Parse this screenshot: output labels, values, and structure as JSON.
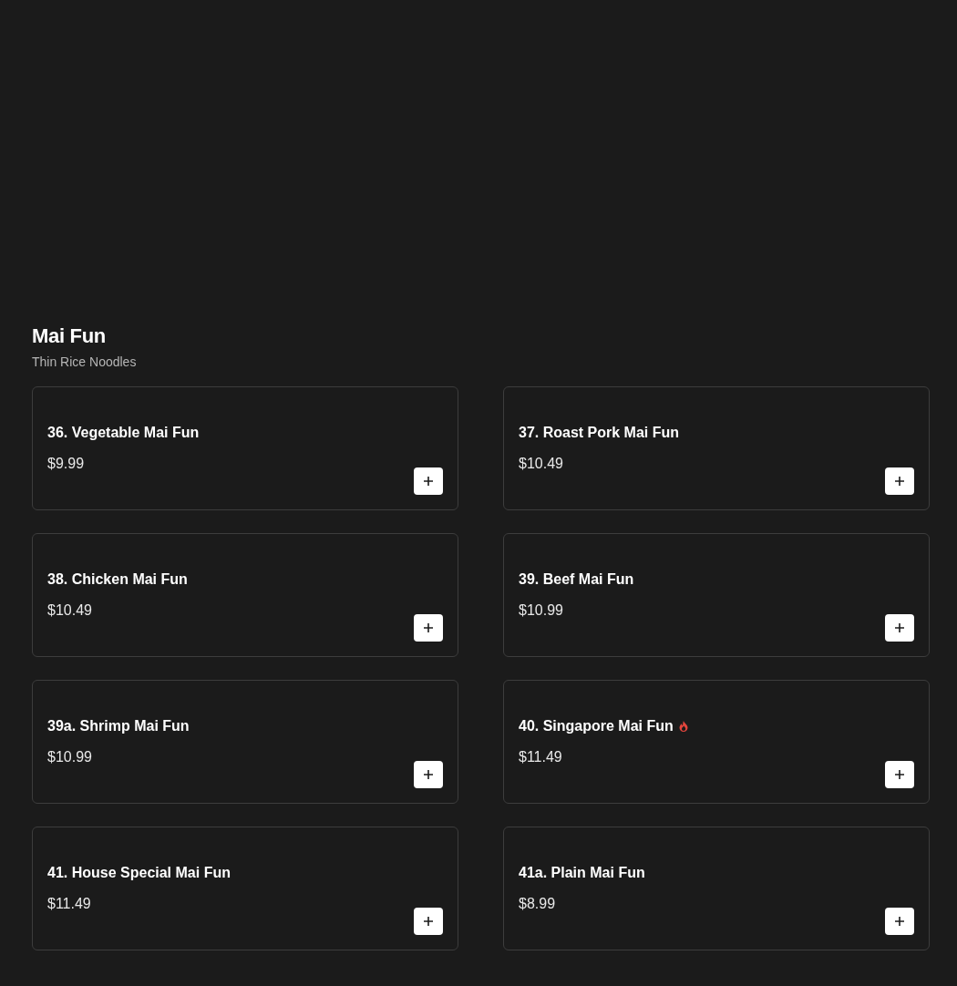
{
  "section": {
    "title": "Mai Fun",
    "subtitle": "Thin Rice Noodles"
  },
  "items": [
    {
      "name": "36. Vegetable Mai Fun",
      "price": "$9.99",
      "spicy": false
    },
    {
      "name": "37. Roast Pork Mai Fun",
      "price": "$10.49",
      "spicy": false
    },
    {
      "name": "38. Chicken Mai Fun",
      "price": "$10.49",
      "spicy": false
    },
    {
      "name": "39. Beef Mai Fun",
      "price": "$10.99",
      "spicy": false
    },
    {
      "name": "39a. Shrimp Mai Fun",
      "price": "$10.99",
      "spicy": false
    },
    {
      "name": "40. Singapore Mai Fun",
      "price": "$11.49",
      "spicy": true
    },
    {
      "name": "41. House Special Mai Fun",
      "price": "$11.49",
      "spicy": false
    },
    {
      "name": "41a. Plain Mai Fun",
      "price": "$8.99",
      "spicy": false
    }
  ]
}
